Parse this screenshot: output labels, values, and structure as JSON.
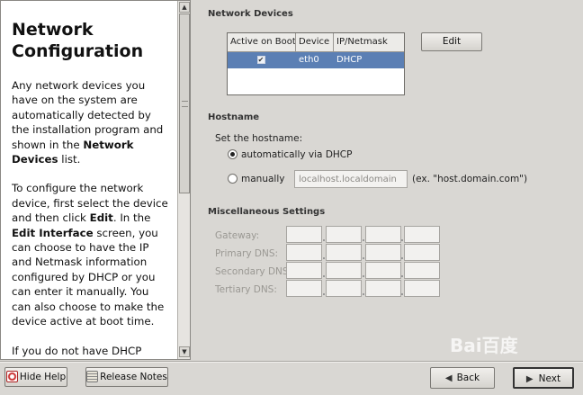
{
  "help": {
    "title": "Network Configuration",
    "p1_pre": "Any network devices you have on the system are automatically detected by the installation program and shown in the ",
    "p1_bold": "Network Devices",
    "p1_post": " list.",
    "p2_a": "To configure the network device, first select the device and then click ",
    "p2_b": "Edit",
    "p2_c": ". In the ",
    "p2_d": "Edit Interface",
    "p2_e": " screen, you can choose to have the IP and Netmask information configured by DHCP or you can enter it manually. You can also choose to make the device active at boot time.",
    "p3": "If you do not have DHCP client access or are unsure as to what this information is, please"
  },
  "network_devices": {
    "section_title": "Network Devices",
    "columns": [
      "Active on Boot",
      "Device",
      "IP/Netmask"
    ],
    "rows": [
      {
        "active": true,
        "device": "eth0",
        "ip_netmask": "DHCP"
      }
    ],
    "edit_button": "Edit"
  },
  "hostname": {
    "section_title": "Hostname",
    "prompt": "Set the hostname:",
    "auto_label": "automatically via DHCP",
    "manual_label": "manually",
    "selected": "automatic",
    "entry_value": "localhost.localdomain",
    "example": "(ex. \"host.domain.com\")"
  },
  "misc": {
    "section_title": "Miscellaneous Settings",
    "fields": [
      "Gateway:",
      "Primary DNS:",
      "Secondary DNS:",
      "Tertiary DNS:"
    ]
  },
  "buttons": {
    "hide_help": "Hide Help",
    "release_notes": "Release Notes",
    "back": "Back",
    "next": "Next"
  },
  "watermark": "Bai百度",
  "icons": {
    "hide_help": "lifebuoy-icon",
    "release_notes": "notes-icon",
    "back": "back-arrow-icon",
    "next": "next-arrow-icon"
  },
  "colors": {
    "selection": "#5b7fb4",
    "background": "#d9d7d3",
    "disabled_text": "#9a9893"
  }
}
